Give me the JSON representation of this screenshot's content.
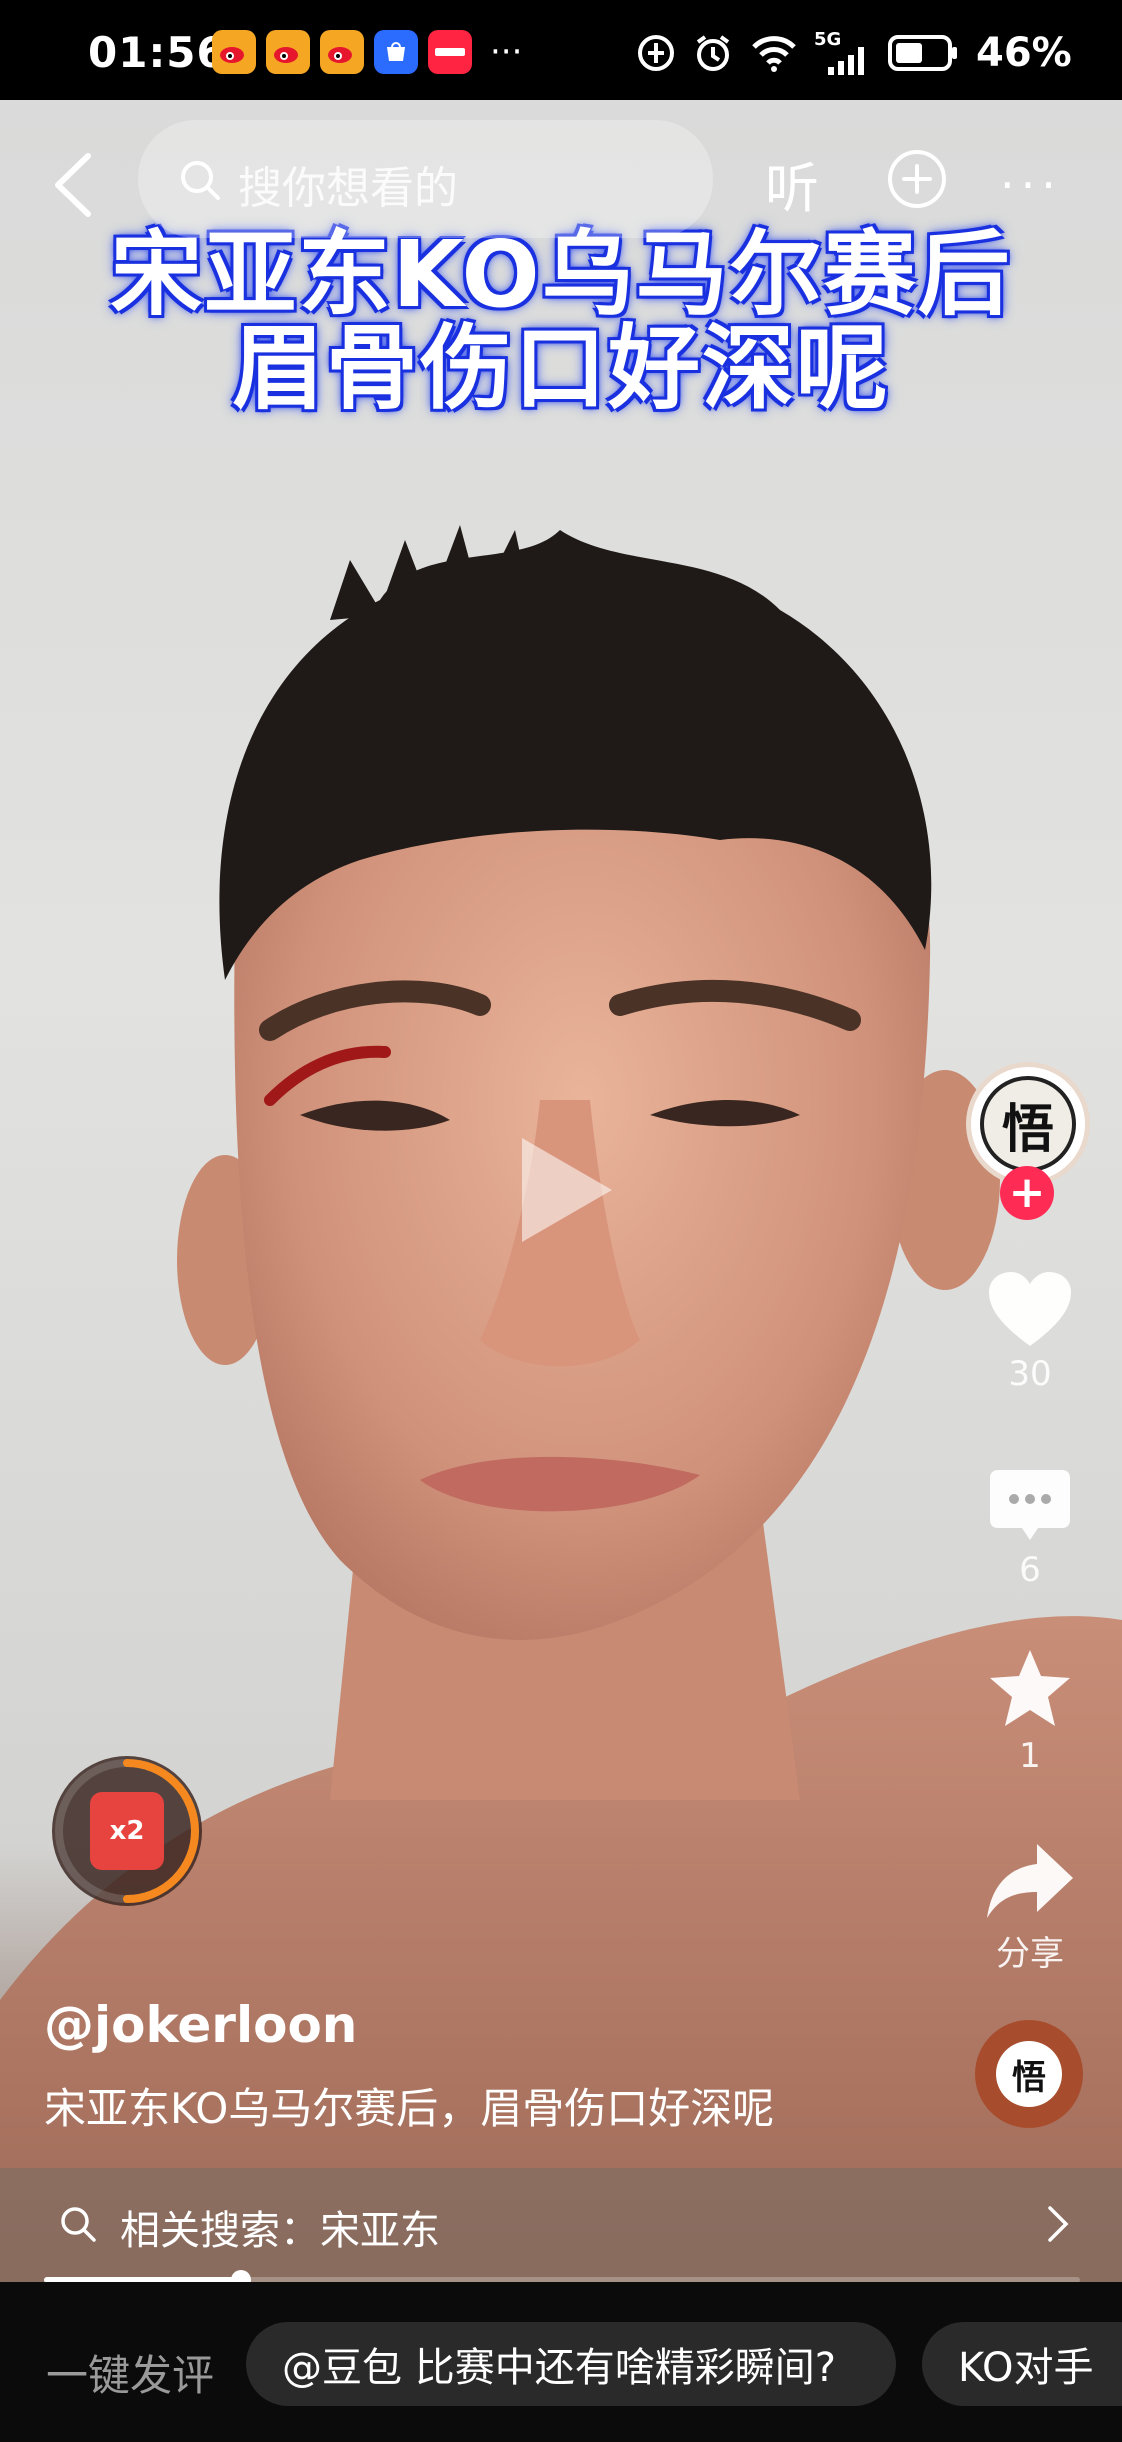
{
  "status_bar": {
    "time": "01:56",
    "more_apps": "···",
    "network": "5G",
    "battery": "46%"
  },
  "topnav": {
    "search_placeholder": "搜你想看的",
    "listen_label": "听",
    "more_label": "···"
  },
  "video": {
    "caption_line1": "宋亚东KO乌马尔赛后",
    "caption_line2": "眉骨伤口好深呢",
    "avatar_char": "悟",
    "follow_symbol": "+",
    "likes": "30",
    "comments": "6",
    "favorites": "1",
    "share_label": "分享",
    "music_char": "悟",
    "redpacket_label": "x2",
    "username": "@jokerloon",
    "description": "宋亚东KO乌马尔赛后，眉骨伤口好深呢",
    "progress": 0.19
  },
  "related_search": {
    "text": "相关搜索：宋亚东"
  },
  "bottom": {
    "quick_comment": "一键发评",
    "chip1": "@豆包 比赛中还有啥精彩瞬间?",
    "chip2": "KO对手"
  },
  "colors": {
    "caption_stroke": "#1b32e0",
    "follow": "#fe2c55",
    "redpacket": "#e8443f"
  }
}
